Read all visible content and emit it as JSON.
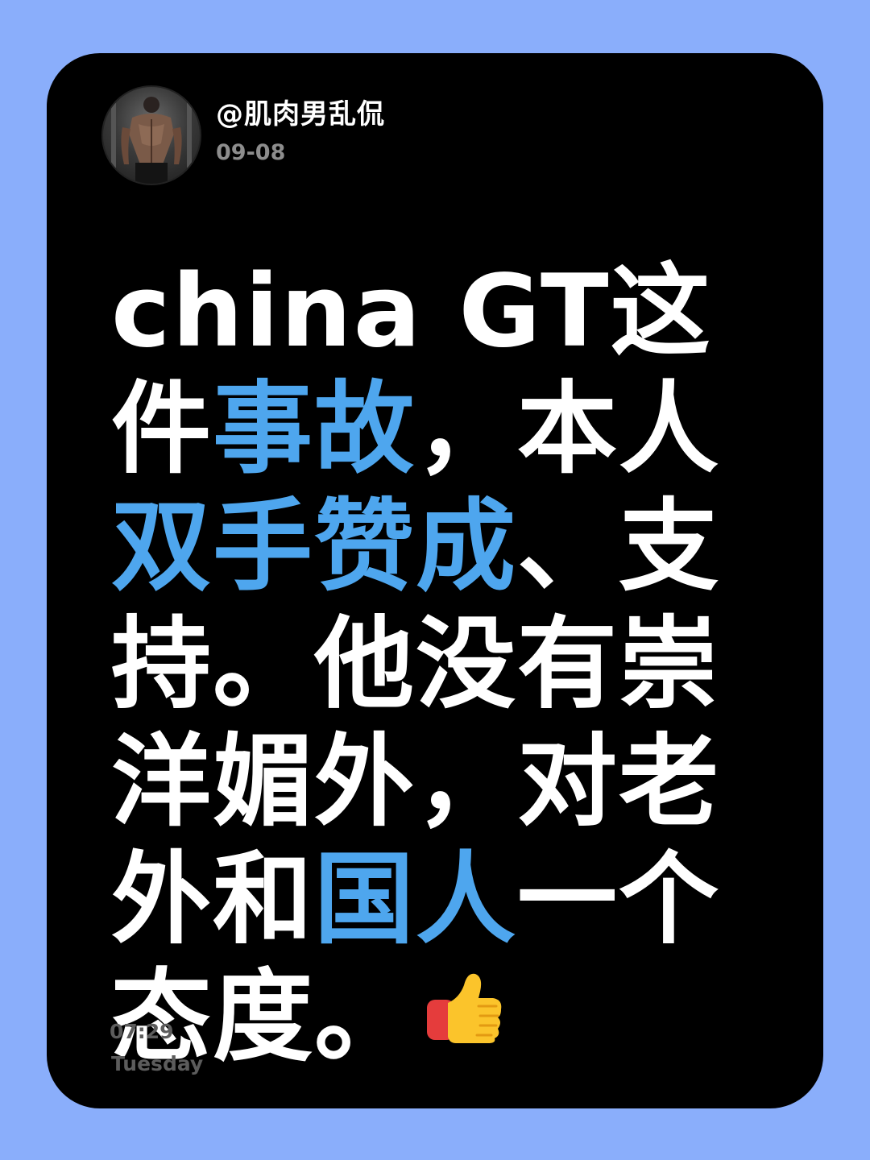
{
  "post": {
    "username": "@肌肉男乱侃",
    "date": "09-08",
    "body_segments": [
      {
        "text": "china  GT这件",
        "highlight": false
      },
      {
        "text": "事故",
        "highlight": true
      },
      {
        "text": "，本人",
        "highlight": false
      },
      {
        "text": "双手赞成",
        "highlight": true
      },
      {
        "text": "、支持。他没有崇洋媚外，对老外和",
        "highlight": false
      },
      {
        "text": "国人",
        "highlight": true
      },
      {
        "text": "一个态度。",
        "highlight": false
      }
    ],
    "emoji": "thumbs-up-icon"
  },
  "footer": {
    "time": "07:29",
    "day": "Tuesday"
  },
  "colors": {
    "background": "#8aaefb",
    "card": "#000000",
    "text": "#ffffff",
    "highlight": "#4ea6ee",
    "muted": "#8d8d8d"
  }
}
